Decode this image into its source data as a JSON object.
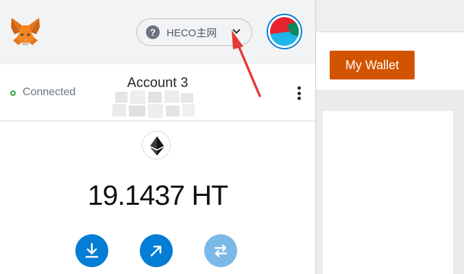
{
  "background_page": {
    "my_wallet_label": "My Wallet",
    "accent_color": "#d35400"
  },
  "metamask": {
    "logo_icon": "metamask-fox-icon",
    "network": {
      "label": "HECO主网",
      "help_icon_glyph": "?",
      "chevron_icon": "chevron-down-icon"
    },
    "account": {
      "connection_status": "Connected",
      "name": "Account 3"
    },
    "balance": "19.1437 HT",
    "actions": {
      "buy_icon": "download-icon",
      "send_icon": "send-arrow-icon",
      "swap_icon": "swap-icon"
    },
    "colors": {
      "primary": "#037dd6",
      "connected": "#28a745",
      "annotation_arrow": "#e53935"
    }
  }
}
